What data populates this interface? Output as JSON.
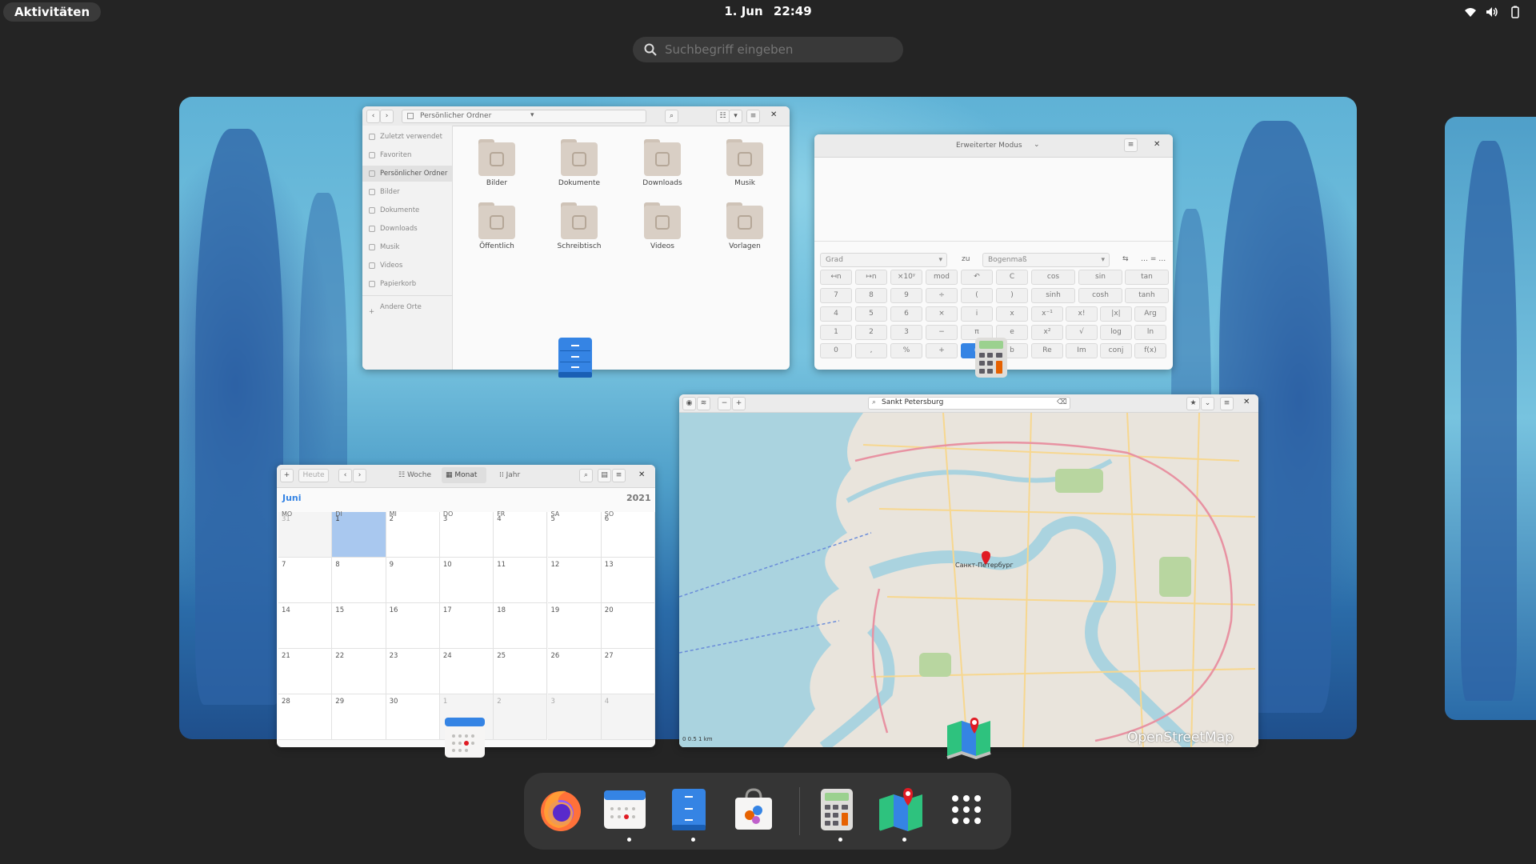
{
  "topbar": {
    "activities": "Aktivitäten",
    "date": "1. Jun",
    "time": "22:49"
  },
  "search": {
    "placeholder": "Suchbegriff eingeben"
  },
  "files": {
    "location": "Persönlicher Ordner",
    "sidebar": [
      "Zuletzt verwendet",
      "Favoriten",
      "Persönlicher Ordner",
      "Bilder",
      "Dokumente",
      "Downloads",
      "Musik",
      "Videos",
      "Papierkorb",
      "Andere Orte"
    ],
    "folders": [
      "Bilder",
      "Dokumente",
      "Downloads",
      "Musik",
      "Öffentlich",
      "Schreibtisch",
      "Videos",
      "Vorlagen"
    ]
  },
  "calculator": {
    "mode": "Erweiterter Modus",
    "angle_unit": "Grad",
    "to_label": "zu",
    "target_unit": "Bogenmaß",
    "keys": [
      [
        "↤n",
        "↦n",
        "×10ʸ",
        "mod",
        "↶",
        "C",
        "cos",
        "sin",
        "tan"
      ],
      [
        "7",
        "8",
        "9",
        "÷",
        "(",
        ")",
        "sinh",
        "cosh",
        "tanh"
      ],
      [
        "4",
        "5",
        "6",
        "×",
        "i",
        "x",
        "x⁻¹",
        "x!",
        "|x|",
        "Arg"
      ],
      [
        "1",
        "2",
        "3",
        "−",
        "π",
        "e",
        "x²",
        "√",
        "log",
        "ln"
      ],
      [
        "0",
        ",",
        "%",
        "+",
        "=",
        "b",
        "Re",
        "Im",
        "conj",
        "f(x)"
      ]
    ]
  },
  "maps": {
    "search": "Sankt Petersburg",
    "city_label": "Санкт-Петербург",
    "scale": "0   0.5   1 km",
    "attribution": "OpenStreetMap"
  },
  "calendar": {
    "today_button": "Heute",
    "views": [
      "Woche",
      "Monat",
      "Jahr"
    ],
    "month": "Juni",
    "year": "2021",
    "weekdays": [
      "MO",
      "DI",
      "MI",
      "DO",
      "FR",
      "SA",
      "SO"
    ],
    "days": [
      [
        "31",
        "1",
        "2",
        "3",
        "4",
        "5",
        "6"
      ],
      [
        "7",
        "8",
        "9",
        "10",
        "11",
        "12",
        "13"
      ],
      [
        "14",
        "15",
        "16",
        "17",
        "18",
        "19",
        "20"
      ],
      [
        "21",
        "22",
        "23",
        "24",
        "25",
        "26",
        "27"
      ],
      [
        "28",
        "29",
        "30",
        "1",
        "2",
        "3",
        "4"
      ]
    ]
  },
  "dash": {
    "apps": [
      "firefox",
      "calendar",
      "files",
      "software",
      "calculator",
      "maps",
      "app-grid"
    ]
  },
  "colors": {
    "accent": "#3584e4",
    "panel": "#242424",
    "today_highlight": "#a9c8ef"
  }
}
